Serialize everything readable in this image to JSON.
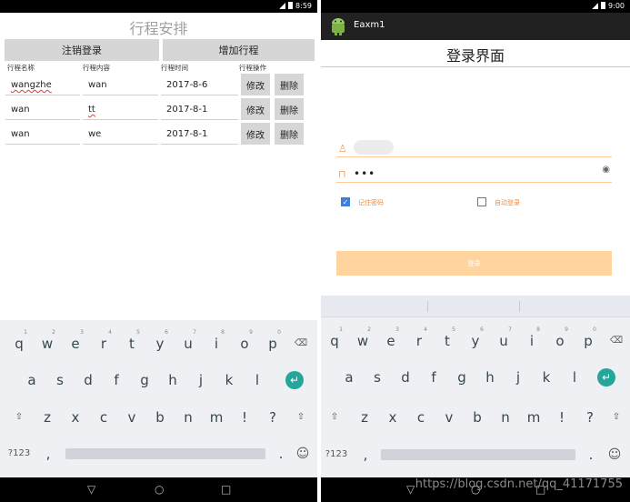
{
  "left": {
    "status_time": "8:59",
    "title": "行程安排",
    "logout_button": "注销登录",
    "add_button": "增加行程",
    "headers": [
      "行程名称",
      "行程内容",
      "行程时间",
      "行程操作"
    ],
    "rows": [
      {
        "name": "wangzhe",
        "content": "wan",
        "time": "2017-8-6",
        "edit": "修改",
        "delete": "删除"
      },
      {
        "name": "wan",
        "content": "tt",
        "time": "2017-8-1",
        "edit": "修改",
        "delete": "删除"
      },
      {
        "name": "wan",
        "content": "we",
        "time": "2017-8-1",
        "edit": "修改",
        "delete": "删除"
      }
    ]
  },
  "right": {
    "status_time": "9:00",
    "app_title": "Eaxm1",
    "page_title": "登录界面",
    "password_dots": "•••",
    "remember_label": "记住密码",
    "auto_login_label": "自动登录",
    "login_button": "登录",
    "remember_checked": true,
    "auto_login_checked": false
  },
  "keyboard": {
    "row1": [
      "q",
      "w",
      "e",
      "r",
      "t",
      "y",
      "u",
      "i",
      "o",
      "p"
    ],
    "row1_nums": [
      "1",
      "2",
      "3",
      "4",
      "5",
      "6",
      "7",
      "8",
      "9",
      "0"
    ],
    "row2": [
      "a",
      "s",
      "d",
      "f",
      "g",
      "h",
      "j",
      "k",
      "l"
    ],
    "row3": [
      "z",
      "x",
      "c",
      "v",
      "b",
      "n",
      "m",
      "!",
      "?"
    ],
    "symbols_key": "?123",
    "comma_key": ",",
    "period_key": ".",
    "emoji_key": "☺"
  },
  "watermark": "https://blog.csdn.net/qq_41171755",
  "colors": {
    "accent": "#f5a05a",
    "login_button": "#ffd49e",
    "enter_key": "#26a69a"
  }
}
